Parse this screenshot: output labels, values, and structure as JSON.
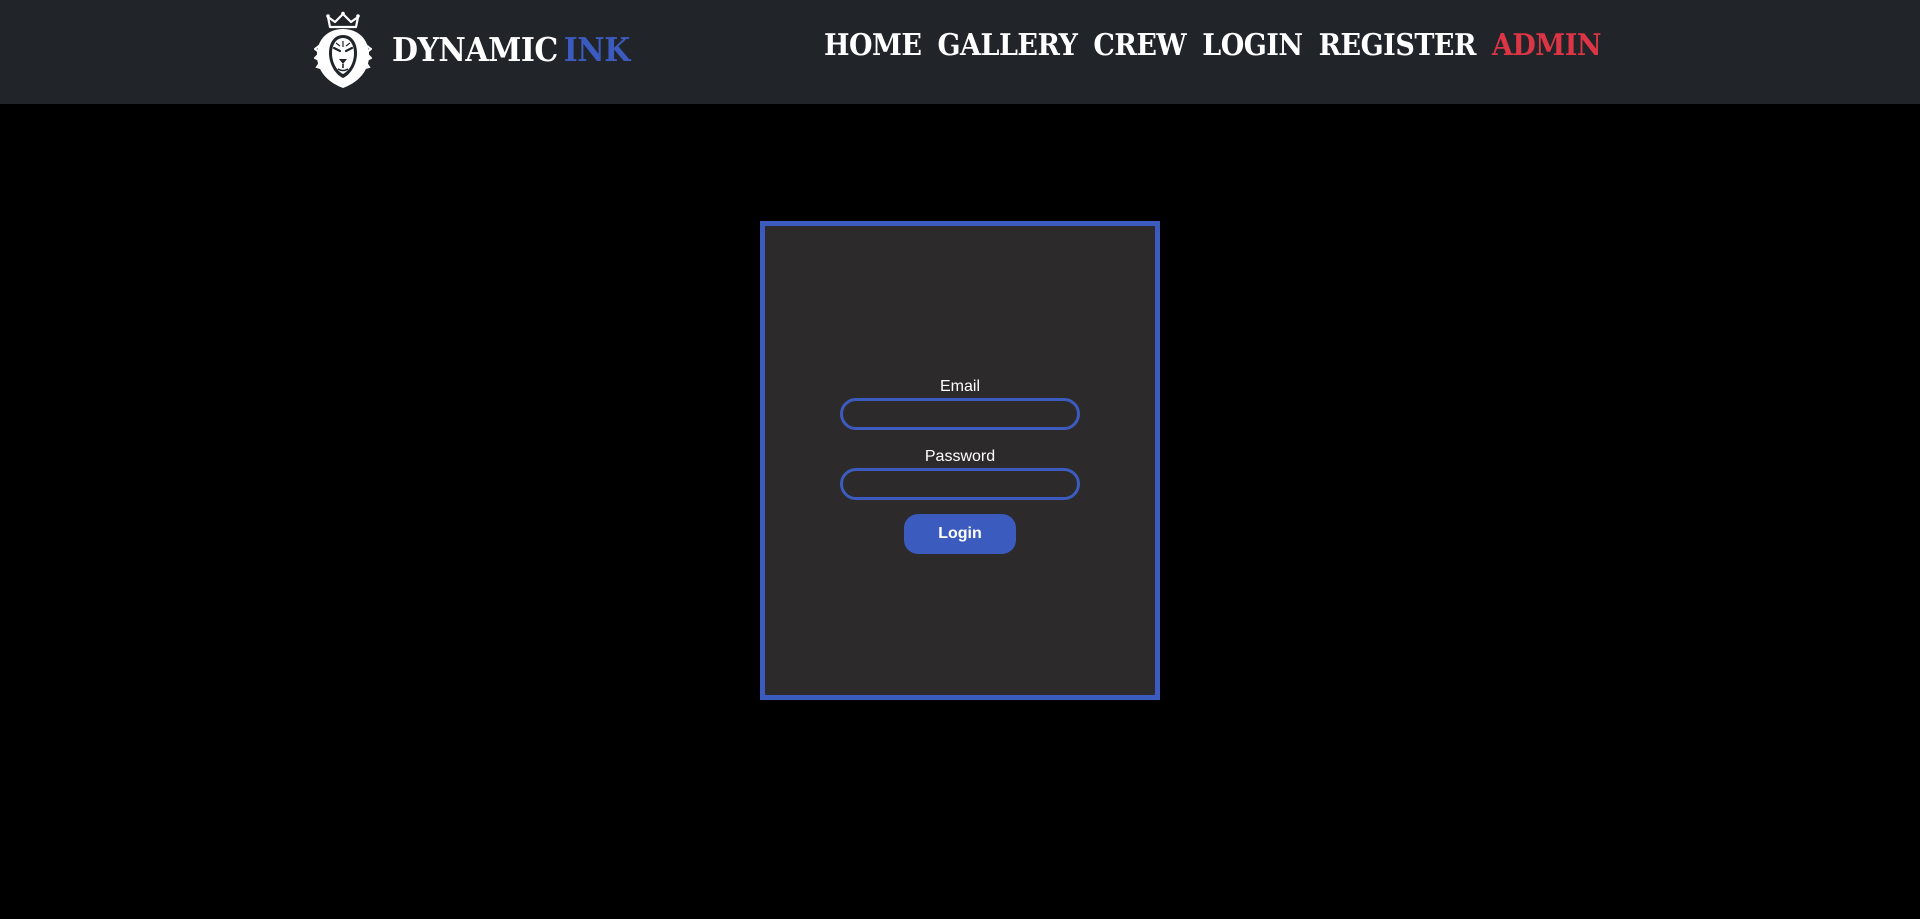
{
  "brand": {
    "name_main": "DYNAMIC",
    "name_accent": "INK",
    "logo_icon": "crowned-lion-icon"
  },
  "nav": {
    "items": [
      {
        "label": "HOME"
      },
      {
        "label": "GALLERY"
      },
      {
        "label": "CREW"
      },
      {
        "label": "LOGIN"
      },
      {
        "label": "REGISTER"
      },
      {
        "label": "ADMIN"
      }
    ]
  },
  "login_form": {
    "email_label": "Email",
    "email_value": "",
    "password_label": "Password",
    "password_value": "",
    "submit_label": "Login"
  },
  "colors": {
    "navbar_bg": "#212429",
    "page_bg": "#000000",
    "card_bg": "#2d2a2b",
    "accent_blue": "#3c5bbf",
    "admin_red": "#dc3545",
    "text": "#ffffff"
  }
}
